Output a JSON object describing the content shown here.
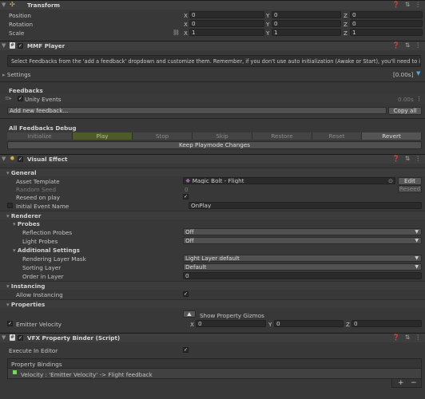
{
  "transform": {
    "title": "Transform",
    "rows": [
      {
        "label": "Position",
        "x": "0",
        "y": "0",
        "z": "0"
      },
      {
        "label": "Rotation",
        "x": "0",
        "y": "0",
        "z": "0"
      },
      {
        "label": "Scale",
        "x": "1",
        "y": "1",
        "z": "1"
      }
    ]
  },
  "axis": {
    "x": "X",
    "y": "Y",
    "z": "Z"
  },
  "mmf": {
    "title": "MMF Player",
    "help": "Select Feedbacks from the 'add a feedback' dropdown and customize them. Remember, if you don't use auto initialization (Awake or Start), you'll need to initialize them via script.",
    "settings_label": "Settings",
    "settings_value": "[0.00s]",
    "feedbacks_label": "Feedbacks",
    "feedback_item": "Unity Events",
    "feedback_item_time": "0.00s",
    "add_feedback": "Add new feedback...",
    "copy_all": "Copy all",
    "debug_label": "All Feedbacks Debug",
    "debug_buttons": [
      "Initialize",
      "Play",
      "Stop",
      "Skip",
      "Restore",
      "Reset",
      "Revert"
    ],
    "keep_playmode": "Keep Playmode Changes"
  },
  "vfx": {
    "title": "Visual Effect",
    "general": "General",
    "asset_template_label": "Asset Template",
    "asset_template_value": "Magic Bolt - Flight",
    "edit": "Edit",
    "random_seed_label": "Random Seed",
    "random_seed_value": "0",
    "reseed": "Reseed",
    "reseed_on_play_label": "Reseed on play",
    "initial_event_label": "Initial Event Name",
    "initial_event_value": "OnPlay",
    "renderer": "Renderer",
    "probes": "Probes",
    "reflection_probes_label": "Reflection Probes",
    "reflection_probes_value": "Off",
    "light_probes_label": "Light Probes",
    "light_probes_value": "Off",
    "additional": "Additional Settings",
    "rlm_label": "Rendering Layer Mask",
    "rlm_value": "Light Layer default",
    "sorting_layer_label": "Sorting Layer",
    "sorting_layer_value": "Default",
    "order_label": "Order in Layer",
    "order_value": "0",
    "instancing": "Instancing",
    "allow_instancing_label": "Allow Instancing",
    "properties": "Properties",
    "show_gizmos": "Show Property Gizmos",
    "emitter_velocity_label": "Emitter Velocity",
    "ev_x": "0",
    "ev_y": "0",
    "ev_z": "0"
  },
  "binder": {
    "title": "VFX Property Binder (Script)",
    "execute_label": "Execute In Editor",
    "bindings_label": "Property Bindings",
    "binding_item": "Velocity : 'Emitter Velocity' -> Flight feedback",
    "add": "+",
    "remove": "−"
  },
  "colors": {
    "background": "#383838",
    "play_active": "#4d5a2a",
    "binding_green": "#7cd36a",
    "pink": "#c0306c"
  }
}
